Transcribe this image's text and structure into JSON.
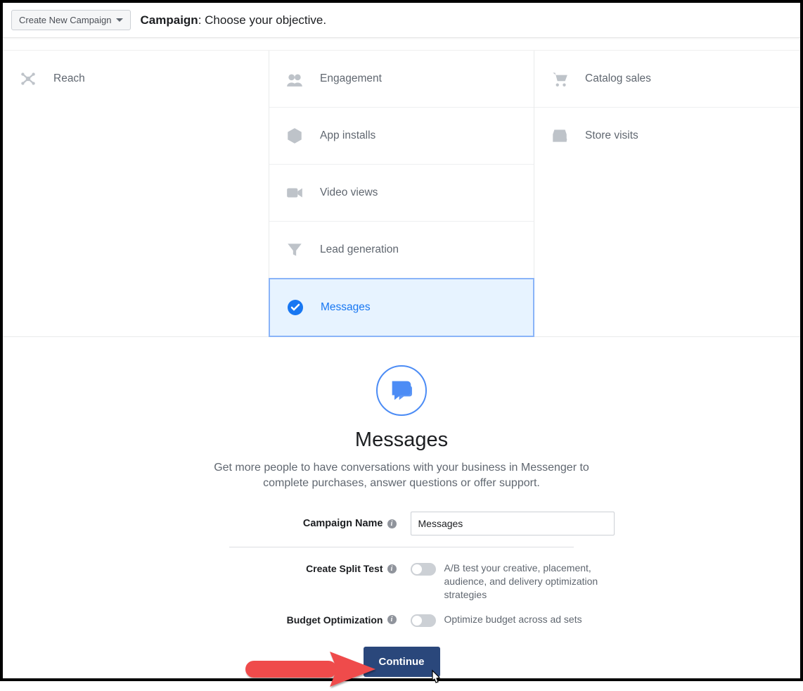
{
  "header": {
    "dropdown_label": "Create New Campaign",
    "breadcrumb_strong": "Campaign",
    "breadcrumb_rest": ": Choose your objective."
  },
  "objectives": {
    "reach": "Reach",
    "engagement": "Engagement",
    "app_installs": "App installs",
    "video_views": "Video views",
    "lead_generation": "Lead generation",
    "messages": "Messages",
    "catalog_sales": "Catalog sales",
    "store_visits": "Store visits"
  },
  "detail": {
    "title": "Messages",
    "description": "Get more people to have conversations with your business in Messenger to complete purchases, answer questions or offer support.",
    "campaign_name_label": "Campaign Name",
    "campaign_name_value": "Messages",
    "split_test_label": "Create Split Test",
    "split_test_desc": "A/B test your creative, placement, audience, and delivery optimization strategies",
    "budget_opt_label": "Budget Optimization",
    "budget_opt_desc": "Optimize budget across ad sets",
    "continue_label": "Continue"
  },
  "colors": {
    "accent": "#1877f2",
    "selected_bg": "#e7f3ff",
    "button_bg": "#2a477b",
    "arrow": "#ef4b4b"
  }
}
